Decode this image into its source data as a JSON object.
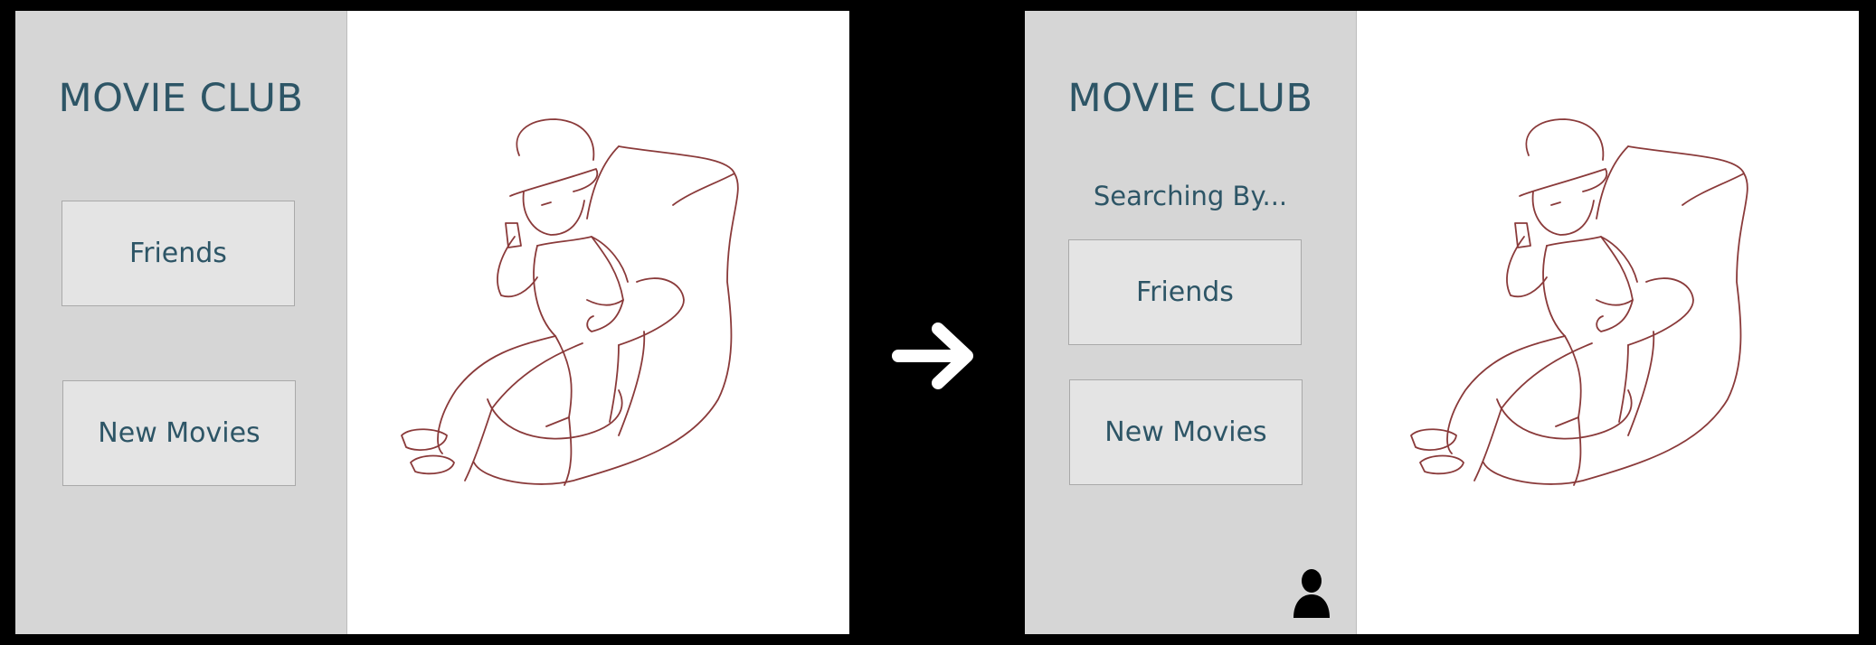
{
  "screens": {
    "before": {
      "title": "MOVIE CLUB",
      "buttons": {
        "friends": "Friends",
        "new_movies": "New Movies"
      }
    },
    "after": {
      "title": "MOVIE CLUB",
      "subtitle": "Searching By...",
      "buttons": {
        "friends": "Friends",
        "new_movies": "New Movies"
      },
      "profile_icon": "user-profile-icon"
    }
  },
  "transition_icon": "right-arrow-icon",
  "illustration_icon": "person-in-armchair-illustration",
  "colors": {
    "background": "#000000",
    "sidebar": "#d6d6d6",
    "button_fill": "#e4e4e4",
    "text_teal": "#2d5566",
    "sketch_line": "#8a3a3a",
    "canvas": "#ffffff"
  }
}
